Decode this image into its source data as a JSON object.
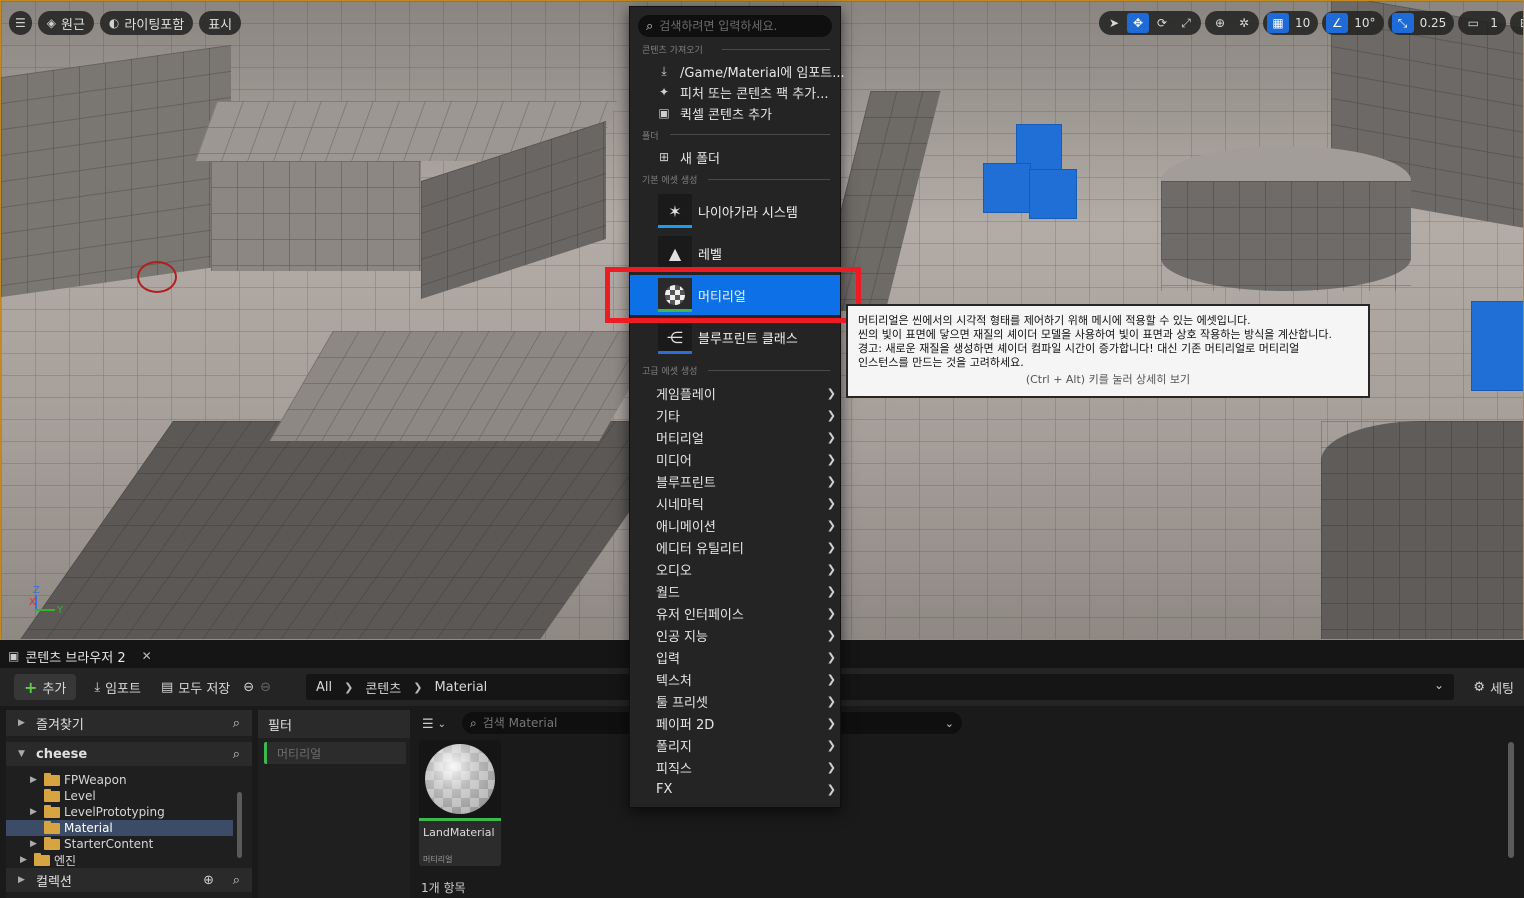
{
  "viewport": {
    "perspective_label": "원근",
    "lighting_label": "라이팅포함",
    "show_label": "표시",
    "grid_snap_value": "10",
    "rotation_snap_value": "10°",
    "scale_snap_value": "0.25",
    "camera_speed_value": "1",
    "axis_z": "Z",
    "axis_x": "X",
    "axis_y": "Y"
  },
  "menu": {
    "search_placeholder": "검색하려면 입력하세요.",
    "section_import": "콘텐츠 가져오기",
    "import_items": [
      {
        "label": "/Game/Material에 임포트...",
        "icon": "import-icon"
      },
      {
        "label": "피처 또는 콘텐츠 팩 추가...",
        "icon": "content-pack-icon"
      },
      {
        "label": "퀵셀 콘텐츠 추가",
        "icon": "quixel-icon"
      }
    ],
    "section_folder": "폴더",
    "new_folder_label": "새 폴더",
    "section_basic": "기본 에셋 생성",
    "basic_items": [
      {
        "label": "나이아가라 시스템",
        "icon": "niagara-icon",
        "underline": "#1b9cf0"
      },
      {
        "label": "레벨",
        "icon": "level-icon",
        "underline": "#8a8a8a"
      },
      {
        "label": "머티리얼",
        "icon": "material-icon",
        "underline": "#3db84f"
      },
      {
        "label": "블루프린트 클래스",
        "icon": "blueprint-icon",
        "underline": "#2f6cd8"
      }
    ],
    "section_advanced": "고급 에셋 생성",
    "advanced_items": [
      "게임플레이",
      "기타",
      "머티리얼",
      "미디어",
      "블루프린트",
      "시네마틱",
      "애니메이션",
      "에디터 유틸리티",
      "오디오",
      "월드",
      "유저 인터페이스",
      "인공 지능",
      "입력",
      "텍스처",
      "툴 프리셋",
      "페이퍼 2D",
      "폴리지",
      "피직스",
      "FX"
    ]
  },
  "tooltip": {
    "line1": "머티리얼은 씬에서의 시각적 형태를 제어하기 위해 메시에 적용할 수 있는 에셋입니다.",
    "line2": "씬의 빛이 표면에 닿으면 재질의 셰이더 모델을 사용하여 빛이 표면과 상호 작용하는 방식을 계산합니다.",
    "line3": "경고: 새로운 재질을 생성하면 셰이더 컴파일 시간이 증가합니다! 대신 기존 머티리얼로 머티리얼",
    "line4": "인스턴스를 만드는 것을 고려하세요.",
    "hint": "(Ctrl + Alt) 키를 눌러 상세히 보기"
  },
  "content_browser": {
    "tab_label": "콘텐츠 브라우저 2",
    "add_label": "추가",
    "import_label": "임포트",
    "save_all_label": "모두 저장",
    "breadcrumbs": [
      "All",
      "콘텐츠",
      "Material"
    ],
    "settings_label": "세팅",
    "favorites_label": "즐겨찾기",
    "project_label": "cheese",
    "tree": [
      {
        "label": "FPWeapon",
        "expandable": true,
        "selected": false
      },
      {
        "label": "Level",
        "expandable": false,
        "selected": false
      },
      {
        "label": "LevelPrototyping",
        "expandable": true,
        "selected": false
      },
      {
        "label": "Material",
        "expandable": false,
        "selected": true
      },
      {
        "label": "StarterContent",
        "expandable": true,
        "selected": false
      },
      {
        "label": "엔진",
        "expandable": true,
        "selected": false
      }
    ],
    "collections_label": "컬렉션",
    "filter_header": "필터",
    "filter_chip": "머티리얼",
    "asset_search_placeholder": "검색 Material",
    "asset": {
      "name": "LandMaterial",
      "type": "머티리얼"
    },
    "item_count": "1개 항목"
  }
}
